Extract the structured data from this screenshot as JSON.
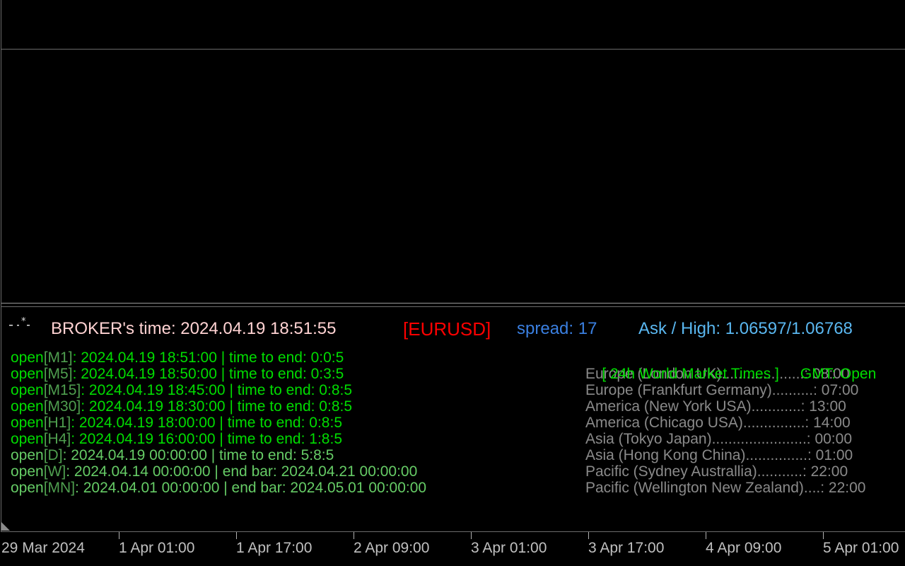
{
  "colors": {
    "background": "#000000",
    "frame": "#6b6b6b",
    "white_text": "#ffd2d2",
    "symbol_red": "#ff0000",
    "spread_blue": "#3a7fe0",
    "ask_blue": "#5ab7f0",
    "lime": "#00dd00",
    "pale_green": "#66cc66",
    "gray_text": "#8a8a8a",
    "axis_text": "#c0c0c0"
  },
  "header": {
    "icon": "asterisk-dash-icon",
    "broker_time_label": "BROKER's time: 2024.04.19 18:51:55",
    "symbol": "[EURUSD]",
    "spread": "spread: 17",
    "ask_high": "Ask / High: 1.06597/1.06768"
  },
  "timeframes": [
    {
      "open": "open",
      "tf": "[M1]",
      "time": ": 2024.04.19 18:51:00",
      "sep": " | ",
      "end_label": "time to end:",
      "end_value": " 0:0:5",
      "color": "lime"
    },
    {
      "open": "open",
      "tf": "[M5]",
      "time": ": 2024.04.19 18:50:00",
      "sep": " | ",
      "end_label": "time to end:",
      "end_value": " 0:3:5",
      "color": "lime"
    },
    {
      "open": "open",
      "tf": "[M15]",
      "time": ": 2024.04.19 18:45:00",
      "sep": " | ",
      "end_label": "time to end:",
      "end_value": " 0:8:5",
      "color": "lime"
    },
    {
      "open": "open",
      "tf": "[M30]",
      "time": ": 2024.04.19 18:30:00",
      "sep": " | ",
      "end_label": "time to end:",
      "end_value": " 0:8:5",
      "color": "lime"
    },
    {
      "open": "open",
      "tf": "[H1]",
      "time": ": 2024.04.19 18:00:00",
      "sep": " | ",
      "end_label": "time to end:",
      "end_value": " 0:8:5",
      "color": "lime"
    },
    {
      "open": "open",
      "tf": "[H4]",
      "time": ": 2024.04.19 16:00:00",
      "sep": " | ",
      "end_label": "time to end:",
      "end_value": " 1:8:5",
      "color": "lime"
    },
    {
      "open": "open",
      "tf": "[D]",
      "time": ": 2024.04.19 00:00:00",
      "sep": " | ",
      "end_label": "time to end:",
      "end_value": " 5:8:5",
      "color": "pale"
    },
    {
      "open": "open",
      "tf": "[W]",
      "time": ": 2024.04.14 00:00:00",
      "sep": " | ",
      "end_label": "end bar:",
      "end_value": " 2024.04.21 00:00:00",
      "color": "pale"
    },
    {
      "open": "open",
      "tf": "[MN]",
      "time": ": 2024.04.01 00:00:00",
      "sep": " | ",
      "end_label": "end bar:",
      "end_value": " 2024.05.01 00:00:00",
      "color": "pale"
    }
  ],
  "market_times": {
    "title": "[ 24h World Market Times ]",
    "gmt_label": "GMT: Open",
    "rows": [
      {
        "text": "Europe (London UK)....................: 08:00"
      },
      {
        "text": "Europe (Frankfurt Germany)..........: 07:00"
      },
      {
        "text": "America (New York USA)............: 13:00"
      },
      {
        "text": "America (Chicago USA)...............: 14:00"
      },
      {
        "text": "Asia (Tokyo Japan).......................: 00:00"
      },
      {
        "text": "Asia (Hong Kong China)...............: 01:00"
      },
      {
        "text": "Pacific (Sydney Australlia)...........: 22:00"
      },
      {
        "text": "Pacific (Wellington New Zealand)....: 22:00"
      }
    ]
  },
  "time_axis": {
    "labels": [
      "29 Mar 2024",
      "1 Apr 01:00",
      "1 Apr 17:00",
      "2 Apr 09:00",
      "3 Apr 01:00",
      "3 Apr 17:00",
      "4 Apr 09:00",
      "5 Apr 01:00"
    ]
  }
}
